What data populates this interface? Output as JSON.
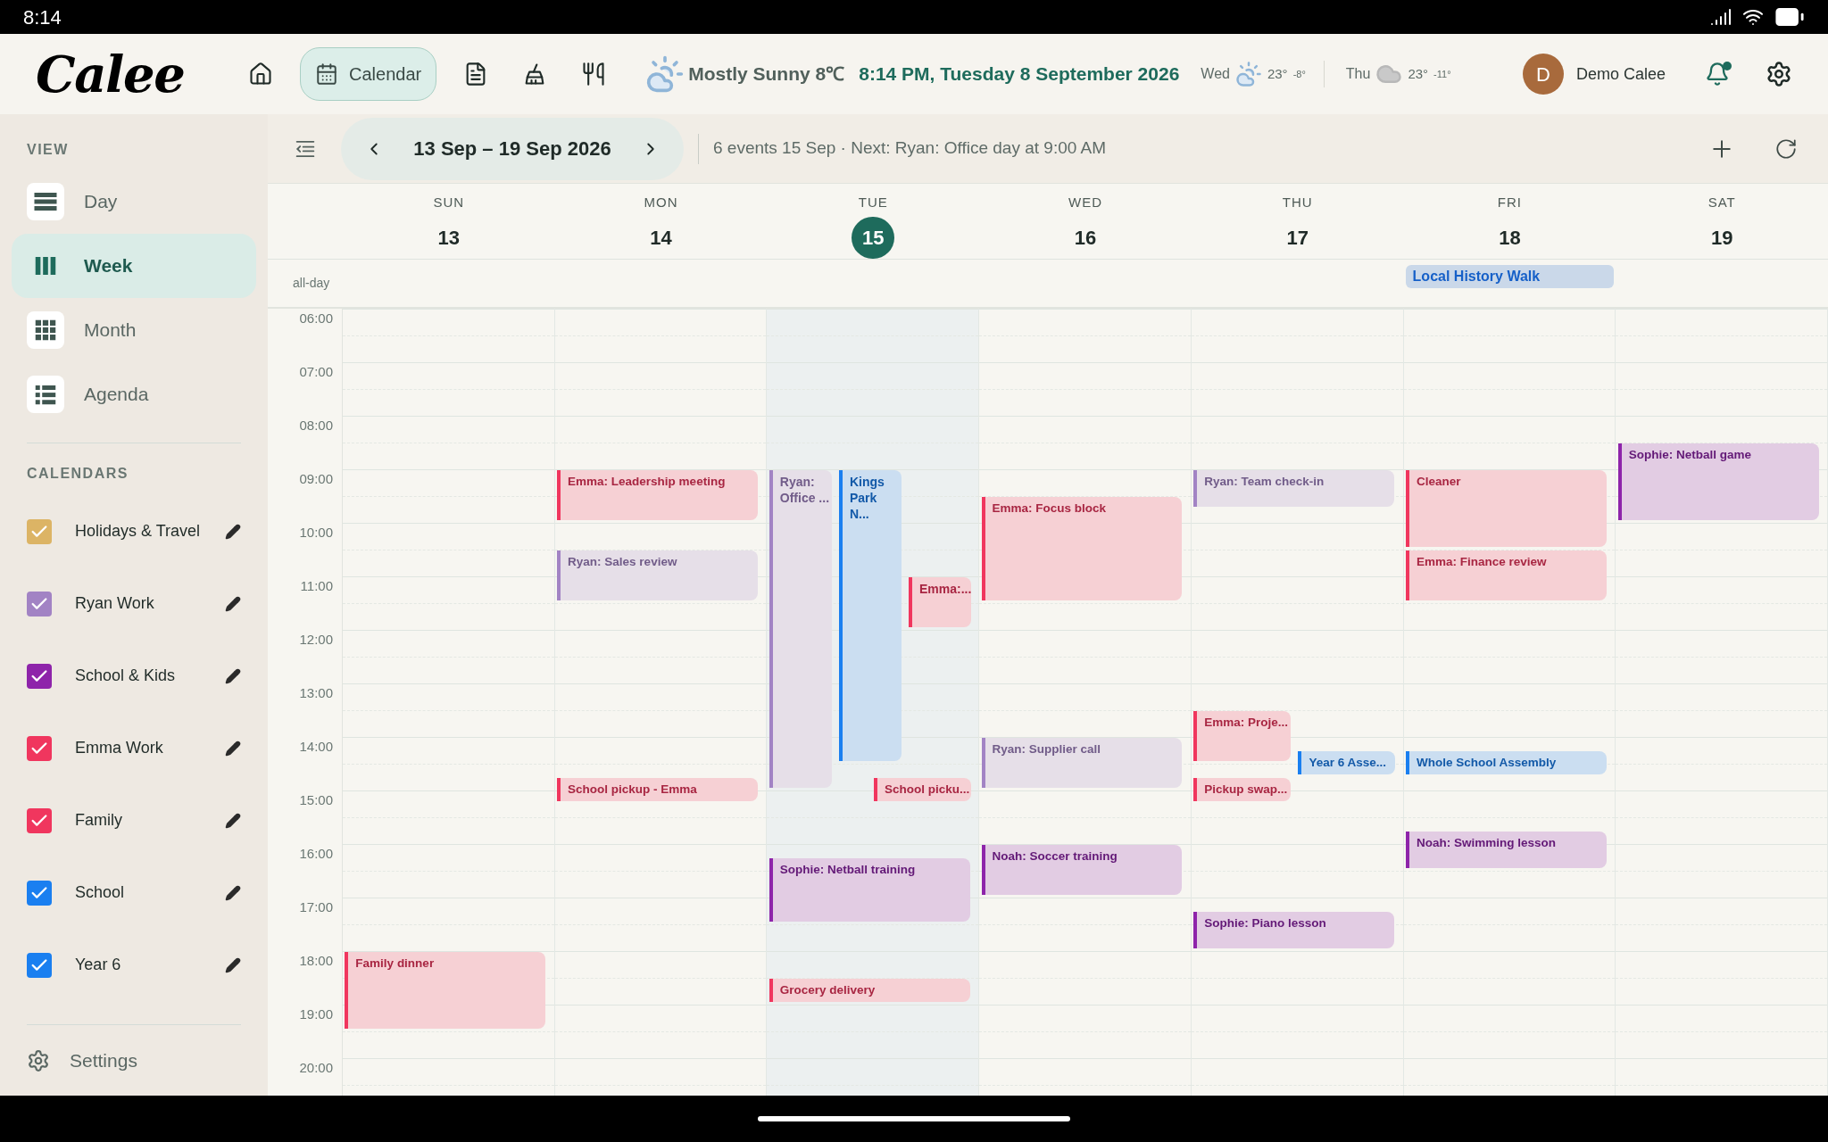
{
  "status_bar": {
    "time": "8:14"
  },
  "header": {
    "logo": "Calee",
    "nav": [
      {
        "kind": "home",
        "selected": false
      },
      {
        "kind": "calendar",
        "label": "Calendar",
        "selected": true
      },
      {
        "kind": "notes",
        "selected": false
      },
      {
        "kind": "cleaning",
        "selected": false
      },
      {
        "kind": "meals",
        "selected": false
      }
    ],
    "weather": {
      "kind": "partly_cloudy",
      "condition": "Mostly Sunny 8℃",
      "datetime": "8:14 PM, Tuesday 8 September 2026",
      "forecast": [
        {
          "day": "Wed",
          "kind": "partly_cloudy",
          "high": "23°",
          "low": "-8°"
        },
        {
          "day": "Thu",
          "kind": "cloudy",
          "high": "23°",
          "low": "-11°"
        }
      ]
    },
    "user": {
      "initial": "D",
      "name": "Demo Calee"
    },
    "notifications": {
      "unread": true
    }
  },
  "sidebar": {
    "view_heading": "VIEW",
    "views": [
      {
        "kind": "day",
        "label": "Day",
        "selected": false
      },
      {
        "kind": "week",
        "label": "Week",
        "selected": true
      },
      {
        "kind": "month",
        "label": "Month",
        "selected": false
      },
      {
        "kind": "agenda",
        "label": "Agenda",
        "selected": false
      }
    ],
    "calendars_heading": "CALENDARS",
    "calendars": [
      {
        "name": "Holidays & Travel",
        "color": "#dcb465",
        "checked": true
      },
      {
        "name": "Ryan Work",
        "color": "#a283c4",
        "checked": true
      },
      {
        "name": "School & Kids",
        "color": "#8e24aa",
        "checked": true
      },
      {
        "name": "Emma Work",
        "color": "#f0365e",
        "checked": true
      },
      {
        "name": "Family",
        "color": "#f0365e",
        "checked": true
      },
      {
        "name": "School",
        "color": "#1a7ff0",
        "checked": true
      },
      {
        "name": "Year 6",
        "color": "#1a7ff0",
        "checked": true
      }
    ],
    "settings": "Settings"
  },
  "toolbar": {
    "range": "13 Sep – 19 Sep 2026",
    "summary": "6 events 15 Sep · Next: Ryan: Office day at 9:00 AM"
  },
  "week": {
    "all_day_label": "all-day",
    "hours": [
      "06:00",
      "07:00",
      "08:00",
      "09:00",
      "10:00",
      "11:00",
      "12:00",
      "13:00",
      "14:00",
      "15:00",
      "16:00",
      "17:00",
      "18:00",
      "19:00",
      "20:00"
    ],
    "days": [
      {
        "name": "SUN",
        "date": "13",
        "selected": false,
        "events": [
          {
            "title": "Family dinner",
            "color": "#f0365e"
          }
        ]
      },
      {
        "name": "MON",
        "date": "14",
        "selected": false,
        "events": [
          {
            "title": "Emma: Leadership meeting",
            "color": "#f0365e"
          },
          {
            "title": "Ryan: Sales review",
            "color": "#a283c4"
          },
          {
            "title": "School pickup - Emma",
            "color": "#f0365e"
          }
        ]
      },
      {
        "name": "TUE",
        "date": "15",
        "selected": true,
        "events": [
          {
            "title": "Ryan: Office ...",
            "color": "#a283c4"
          },
          {
            "title": "Kings Park N...",
            "color": "#1a7ff0"
          },
          {
            "title": "Emma:...",
            "color": "#f0365e"
          },
          {
            "title": "School picku...",
            "color": "#f0365e"
          },
          {
            "title": "Sophie: Netball training",
            "color": "#8e24aa"
          },
          {
            "title": "Grocery delivery",
            "color": "#f0365e"
          }
        ]
      },
      {
        "name": "WED",
        "date": "16",
        "selected": false,
        "events": [
          {
            "title": "Emma: Focus block",
            "color": "#f0365e"
          },
          {
            "title": "Ryan: Supplier call",
            "color": "#a283c4"
          },
          {
            "title": "Noah: Soccer training",
            "color": "#8e24aa"
          }
        ]
      },
      {
        "name": "THU",
        "date": "17",
        "selected": false,
        "events": [
          {
            "title": "Ryan: Team check-in",
            "color": "#a283c4"
          },
          {
            "title": "Emma: Proje...",
            "color": "#f0365e"
          },
          {
            "title": "Year 6 Asse...",
            "color": "#1a7ff0"
          },
          {
            "title": "Pickup swap...",
            "color": "#f0365e"
          },
          {
            "title": "Sophie: Piano lesson",
            "color": "#8e24aa"
          }
        ]
      },
      {
        "name": "FRI",
        "date": "18",
        "selected": false,
        "all_day": [
          {
            "title": "Local History Walk",
            "color": "#1660c8"
          }
        ],
        "events": [
          {
            "title": "Cleaner",
            "color": "#f0365e"
          },
          {
            "title": "Emma: Finance review",
            "color": "#f0365e"
          },
          {
            "title": "Whole School Assembly",
            "color": "#1a7ff0"
          },
          {
            "title": "Noah: Swimming lesson",
            "color": "#8e24aa"
          }
        ]
      },
      {
        "name": "SAT",
        "date": "19",
        "selected": false,
        "events": [
          {
            "title": "Sophie: Netball game",
            "color": "#8e24aa"
          }
        ]
      }
    ]
  }
}
